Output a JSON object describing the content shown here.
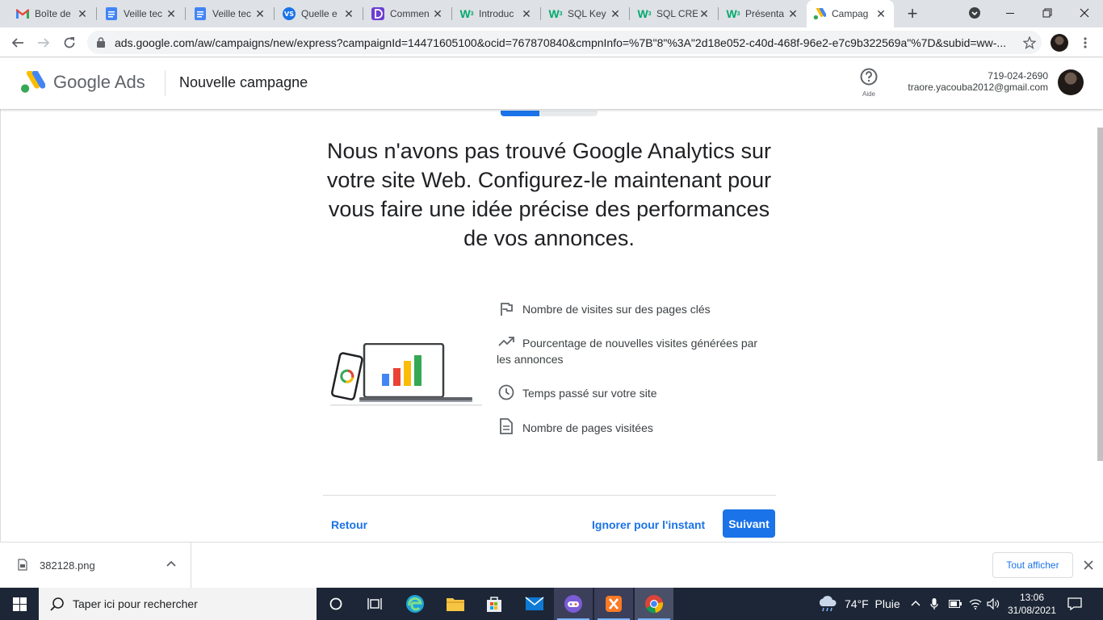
{
  "browser": {
    "tabs": [
      {
        "title": "Boîte de",
        "icon": "gmail-icon",
        "active": false
      },
      {
        "title": "Veille tec",
        "icon": "google-docs-icon",
        "active": false
      },
      {
        "title": "Veille tec",
        "icon": "google-docs-icon",
        "active": false
      },
      {
        "title": "Quelle e",
        "icon": "vs-icon",
        "active": false
      },
      {
        "title": "Commen",
        "icon": "app-d-icon",
        "active": false
      },
      {
        "title": "Introduc",
        "icon": "w3schools-icon",
        "active": false
      },
      {
        "title": "SQL Key",
        "icon": "w3schools-icon",
        "active": false
      },
      {
        "title": "SQL CRE",
        "icon": "w3schools-icon",
        "active": false
      },
      {
        "title": "Présenta",
        "icon": "w3schools-icon",
        "active": false
      },
      {
        "title": "Campag",
        "icon": "google-ads-icon",
        "active": true
      }
    ],
    "url": "ads.google.com/aw/campaigns/new/express?campaignId=14471605100&ocid=767870840&cmpnInfo=%7B\"8\"%3A\"2d18e052-c40d-468f-96e2-e7c9b322569a\"%7D&subid=ww-..."
  },
  "header": {
    "brand": "Google Ads",
    "page_title": "Nouvelle campagne",
    "help_label": "Aide",
    "account_id": "719-024-2690",
    "account_email": "traore.yacouba2012@gmail.com"
  },
  "main": {
    "progress_fraction": 0.4,
    "headline": "Nous n'avons pas trouvé Google Analytics sur votre site Web. Configurez-le maintenant pour vous faire une idée précise des performances de vos annonces.",
    "features": [
      {
        "icon": "flag-icon",
        "text": "Nombre de visites sur des pages clés"
      },
      {
        "icon": "trending-up-icon",
        "text": "Pourcentage de nouvelles visites générées par les annonces"
      },
      {
        "icon": "clock-icon",
        "text": "Temps passé sur votre site"
      },
      {
        "icon": "document-icon",
        "text": "Nombre de pages visitées"
      }
    ],
    "back_label": "Retour",
    "skip_label": "Ignorer pour l'instant",
    "next_label": "Suivant"
  },
  "downloads": {
    "file_name": "382128.png",
    "show_all_label": "Tout afficher"
  },
  "taskbar": {
    "search_placeholder": "Taper ici pour rechercher",
    "weather": "74°F  Pluie",
    "time": "13:06",
    "date": "31/08/2021"
  },
  "colors": {
    "accent": "#1a73e8",
    "taskbar_bg": "#1c2636",
    "tabstrip_bg": "#dee1e6"
  }
}
